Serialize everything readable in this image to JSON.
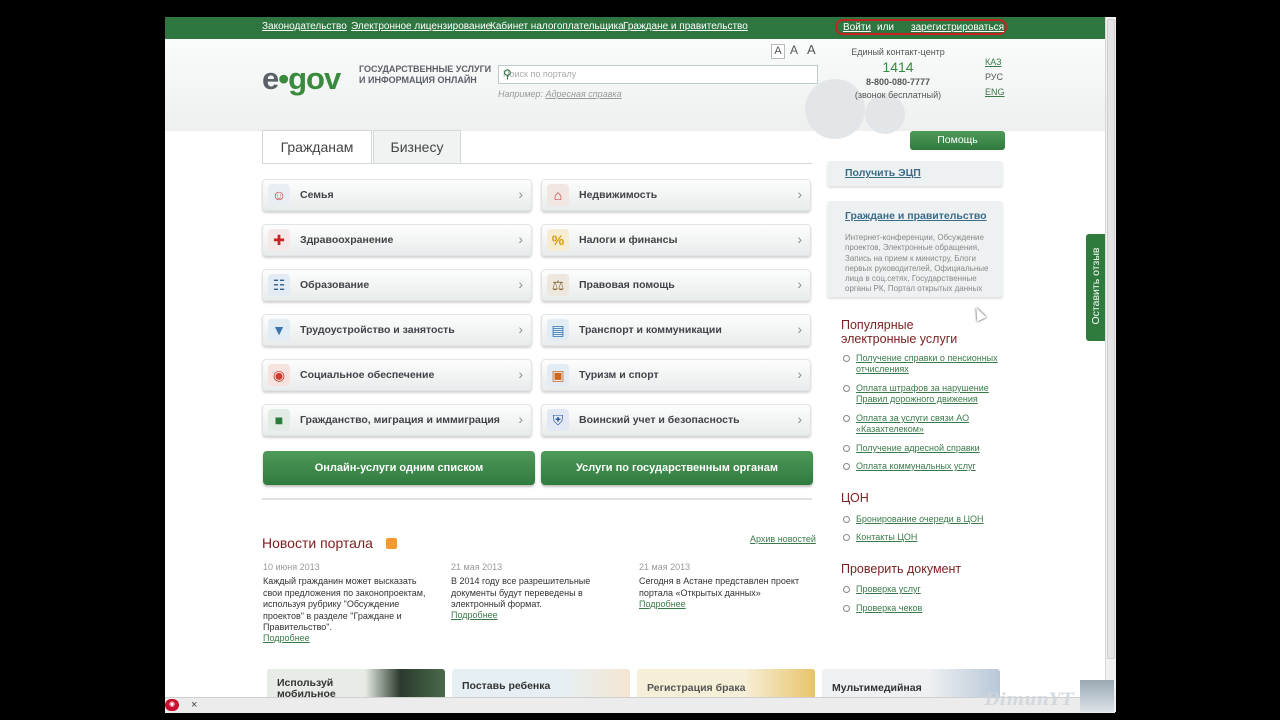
{
  "colors": {
    "brand_green": "#2e7540",
    "accent_red": "#7a1f1f",
    "link": "#3a6c8a"
  },
  "topbar": {
    "links": [
      "Законодательство",
      "Электронное лицензирование",
      "Кабинет налогоплательщика",
      "Граждане и правительство"
    ],
    "login": "Войти",
    "or": "или",
    "register": "зарегистрироваться"
  },
  "header": {
    "logo_e": "e",
    "logo_gov": "gov",
    "slogan_line1": "ГОСУДАРСТВЕННЫЕ УСЛУГИ",
    "slogan_line2": "И ИНФОРМАЦИЯ ОНЛАЙН",
    "font_sizes": [
      "A",
      "A",
      "A"
    ],
    "search_placeholder": "Поиск по порталу",
    "example_label": "Например:",
    "example_link": "Адресная справка",
    "contact_title": "Единый контакт-центр",
    "contact_number": "1414",
    "contact_phone": "8-800-080-7777",
    "contact_free": "(звонок бесплатный)",
    "languages": [
      "КАЗ",
      "РУС",
      "ENG"
    ]
  },
  "tabs": [
    "Гражданам",
    "Бизнесу"
  ],
  "categories": [
    {
      "label": "Семья",
      "icon": "family-icon"
    },
    {
      "label": "Недвижимость",
      "icon": "house-icon"
    },
    {
      "label": "Здравоохранение",
      "icon": "first-aid-icon"
    },
    {
      "label": "Налоги и финансы",
      "icon": "percent-icon"
    },
    {
      "label": "Образование",
      "icon": "book-icon"
    },
    {
      "label": "Правовая помощь",
      "icon": "scales-icon"
    },
    {
      "label": "Трудоустройство и занятость",
      "icon": "tie-icon"
    },
    {
      "label": "Транспорт и коммуникации",
      "icon": "truck-icon"
    },
    {
      "label": "Социальное обеспечение",
      "icon": "lifebuoy-icon"
    },
    {
      "label": "Туризм и спорт",
      "icon": "diving-mask-icon"
    },
    {
      "label": "Гражданство, миграция и иммиграция",
      "icon": "passport-icon"
    },
    {
      "label": "Воинский учет и безопасность",
      "icon": "shield-icon"
    }
  ],
  "green_buttons": [
    "Онлайн-услуги одним списком",
    "Услуги по государственным органам"
  ],
  "news": {
    "title": "Новости портала",
    "archive": "Архив новостей",
    "items": [
      {
        "date": "10 июня 2013",
        "lines": [
          "Каждый гражданин может высказать",
          "свои предложения по законопроектам,",
          "используя рубрику \"Обсуждение",
          "проектов\" в разделе \"Граждане и",
          "Правительство\"."
        ],
        "more": "Подробнее"
      },
      {
        "date": "21 мая 2013",
        "lines": [
          "В 2014 году все разрешительные",
          "документы будут переведены в",
          "электронный формат."
        ],
        "more": "Подробнее"
      },
      {
        "date": "21 мая 2013",
        "lines": [
          "Сегодня в Астане представлен проект",
          "портала «Открытых данных»"
        ],
        "more": "Подробнее"
      }
    ]
  },
  "banners": [
    {
      "line1": "Используй",
      "line2": "мобильное"
    },
    {
      "line1": "Поставь ребенка",
      "line2": ""
    },
    {
      "line1": "Регистрация брака",
      "line2": ""
    },
    {
      "line1": "Мультимедийная",
      "line2": ""
    }
  ],
  "sidebar": {
    "help": "Помощь",
    "ecp": "Получить ЭЦП",
    "gov_title": "Граждане и правительство",
    "gov_desc": [
      "Интернет-конференции, Обсуждение",
      "проектов, Электронные обращения,",
      "Запись на прием к министру, Блоги",
      "первых руководителей, Официальные",
      "лица в соц.сетях, Государственные",
      "органы РК, Портал открытых данных"
    ],
    "popular_title_1": "Популярные",
    "popular_title_2": "электронные услуги",
    "popular": [
      [
        "Получение справки о пенсионных",
        "отчислениях"
      ],
      [
        "Оплата штрафов за нарушение",
        "Правил дорожного движения"
      ],
      [
        "Оплата за услуги связи АО",
        "«Казахтелеком»"
      ],
      [
        "Получение адресной справки",
        ""
      ],
      [
        "Оплата коммунальных услуг",
        ""
      ]
    ],
    "con_title": "ЦОН",
    "con": [
      "Бронирование очереди в ЦОН",
      "Контакты ЦОН"
    ],
    "check_title": "Проверить документ",
    "check": [
      "Проверка услуг",
      "Проверка чеков"
    ],
    "feedback": "Оставить отзыв"
  },
  "watermark": "DimunYT"
}
